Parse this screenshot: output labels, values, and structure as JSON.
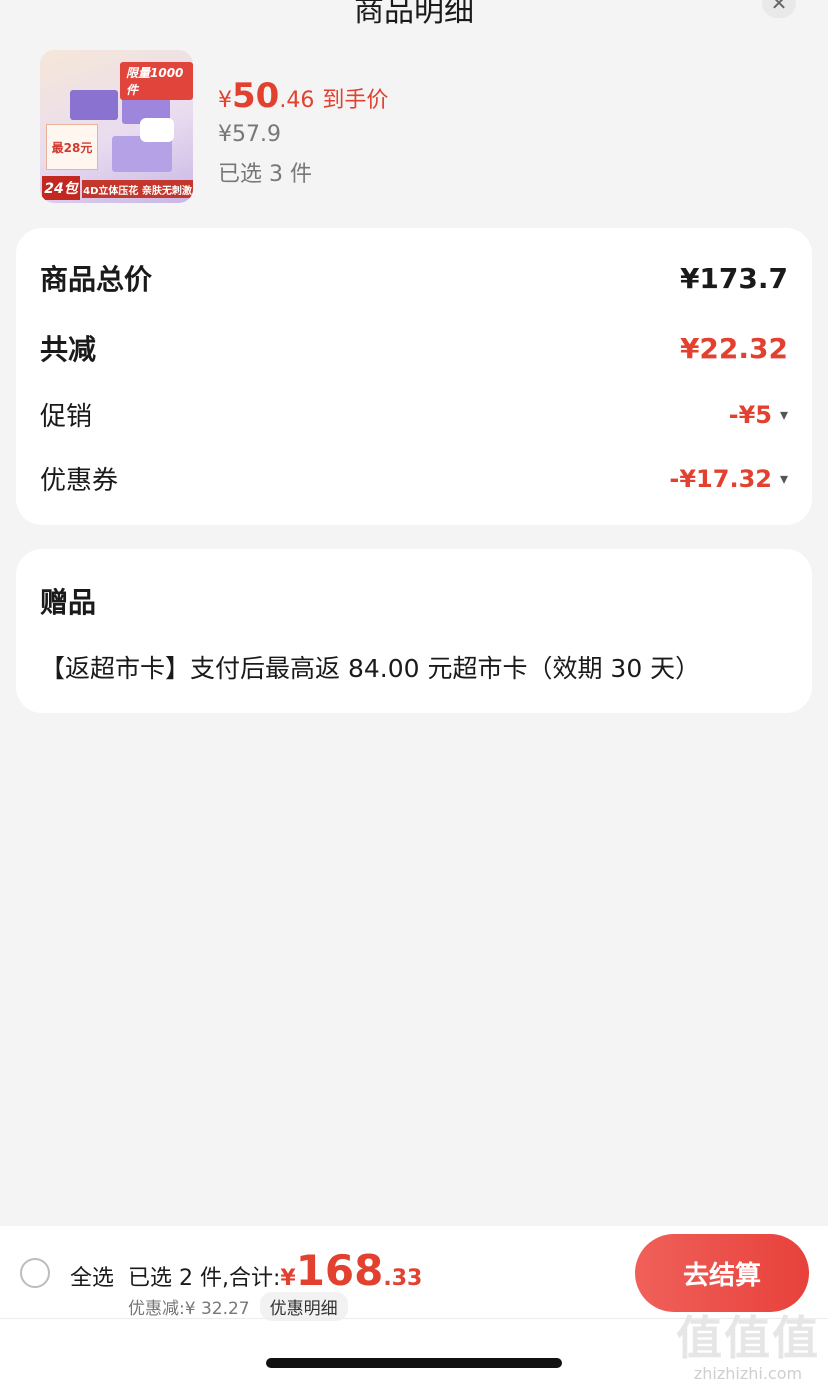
{
  "header": {
    "title": "商品明细",
    "close_icon": "close-icon"
  },
  "product": {
    "image_badge": "限量1000件",
    "image_promo": "最28元",
    "image_pack": "24包",
    "image_banner": "4D立体压花 亲肤无刺激",
    "yen": "¥",
    "price_int": "50",
    "price_dec": ".46",
    "price_tag": "到手价",
    "original_price": "¥57.9",
    "selected_count": "已选 3 件"
  },
  "summary": {
    "total_label": "商品总价",
    "total_value": "¥173.7",
    "reduce_label": "共减",
    "reduce_value": "¥22.32",
    "promo_label": "促销",
    "promo_value": "-¥5",
    "coupon_label": "优惠券",
    "coupon_value": "-¥17.32"
  },
  "gift": {
    "title": "赠品",
    "text": "【返超市卡】支付后最高返 84.00 元超市卡（效期 30 天）"
  },
  "bottom": {
    "select_all": "全选",
    "selected_label": "已选 2 件,合计:",
    "yen": "¥",
    "total_int": "168",
    "total_dec": ".33",
    "discount": "优惠减:¥ 32.27",
    "detail_link": "优惠明细",
    "checkout": "去结算"
  },
  "watermark": {
    "logo": "值值值",
    "site": "zhizhizhi.com"
  },
  "colors": {
    "accent": "#e2412f",
    "button": "#e8413b",
    "background": "#f4f4f4"
  }
}
